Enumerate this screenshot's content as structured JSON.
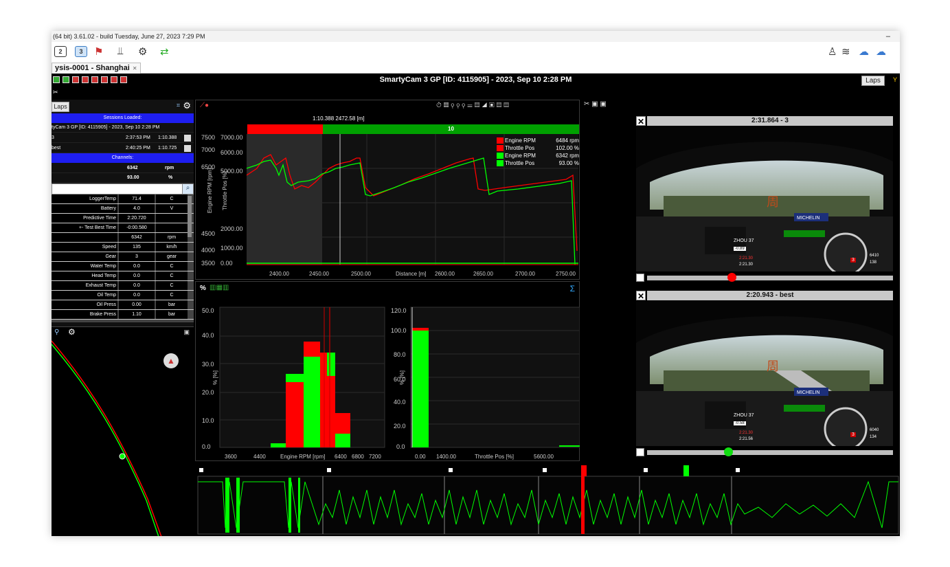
{
  "titlebar": {
    "text": "(64 bit) 3.61.02 - build Tuesday, June 27, 2023 7:29 PM",
    "minimize": "–"
  },
  "toolbar": {
    "view2": "2",
    "view3": "3"
  },
  "tab": {
    "label": "ysis-0001 - Shanghai",
    "close": "✕"
  },
  "header": {
    "title": "SmartyCam 3 GP [ID: 4115905] - 2023, Sep 10 2:28 PM",
    "laps_button": "Laps"
  },
  "left_panel": {
    "laps_button": "Laps",
    "sessions_loaded": "Sessions Loaded:",
    "session": "tyCam 3 GP [ID: 4115905] - 2023, Sep 10 2:28 PM",
    "laps": [
      {
        "name": "3",
        "time": "2:37:53 PM",
        "laptime": "1:10.388"
      },
      {
        "name": "best",
        "time": "2:40:25 PM",
        "laptime": "1:10.725"
      }
    ],
    "channels_label": "Channels:",
    "top_rows": [
      {
        "value": "6342",
        "unit": "rpm"
      },
      {
        "value": "93.00",
        "unit": "%"
      }
    ],
    "channels": [
      {
        "name": "LoggerTemp",
        "value": "71.4",
        "unit": "C"
      },
      {
        "name": "Battery",
        "value": "4.0",
        "unit": "V"
      },
      {
        "name": "Predictive Time",
        "value": "2:20.720",
        "unit": ""
      },
      {
        "name": "+- Test Best Time",
        "value": "-0:00.580",
        "unit": ""
      },
      {
        "name": "",
        "value": "6342",
        "unit": "rpm"
      },
      {
        "name": "Speed",
        "value": "135",
        "unit": "km/h"
      },
      {
        "name": "Gear",
        "value": "3",
        "unit": "gear"
      },
      {
        "name": "Water Temp",
        "value": "0.0",
        "unit": "C"
      },
      {
        "name": "Head Temp",
        "value": "0.0",
        "unit": "C"
      },
      {
        "name": "Exhaust Temp",
        "value": "0.0",
        "unit": "C"
      },
      {
        "name": "Oil Temp",
        "value": "0.0",
        "unit": "C"
      },
      {
        "name": "Oil Press",
        "value": "0.00",
        "unit": "bar"
      },
      {
        "name": "Brake Press",
        "value": "1.10",
        "unit": "bar"
      }
    ]
  },
  "main_chart": {
    "cursor_label": "1:10.388  2472.58 [m]",
    "segment_label": "10",
    "legend": [
      {
        "name": "Engine RPM",
        "value": "6484",
        "unit": "rpm",
        "color": "#ff0000"
      },
      {
        "name": "Throttle Pos",
        "value": "102.00",
        "unit": "%",
        "color": "#ff0000"
      },
      {
        "name": "Engine RPM",
        "value": "6342",
        "unit": "rpm",
        "color": "#00ff00"
      },
      {
        "name": "Throttle Pos",
        "value": "93.00",
        "unit": "%",
        "color": "#00ff00"
      }
    ],
    "y1_ticks": [
      "7500",
      "7000",
      "6500",
      "4500",
      "4000",
      "3500"
    ],
    "y2_ticks": [
      "7000.00",
      "6000.00",
      "5000.00",
      "2000.00",
      "1000.00",
      "0.00"
    ],
    "y1_label": "Engine RPM [rpm]",
    "y2_label": "Throttle Pos [%]",
    "x_ticks": [
      "2400.00",
      "2450.00",
      "2500.00",
      "2600.00",
      "2650.00",
      "2700.00",
      "2750.00"
    ],
    "x_label": "Distance [m]"
  },
  "hist1": {
    "y_ticks": [
      "50.0",
      "40.0",
      "30.0",
      "20.0",
      "10.0",
      "0.0"
    ],
    "y_label": "% [%]",
    "x_ticks": [
      "3600",
      "4400",
      "6400",
      "6800",
      "7200"
    ],
    "x_label": "Engine RPM [rpm]"
  },
  "hist2": {
    "y_ticks": [
      "120.0",
      "100.0",
      "80.0",
      "60.0",
      "40.0",
      "20.0",
      "0.0"
    ],
    "y_label": "% [%]",
    "x_ticks": [
      "0.00",
      "1400.00",
      "5600.00"
    ],
    "x_label": "Throttle Pos [%]"
  },
  "sigma": "Σ",
  "percent_tool": "%",
  "video1": {
    "title": "2:31.864 - 3",
    "hud_name": "ZHOU 37",
    "hud_delta": "-0.89",
    "hud_t1": "2:21.30",
    "hud_t2": "2:21.30",
    "rpm": "6410",
    "speed": "138",
    "gear": "3"
  },
  "video2": {
    "title": "2:20.943 - best",
    "hud_name": "ZHOU 37",
    "hud_delta": "-0.58",
    "hud_t1": "2:21.30",
    "hud_t2": "2:21.56",
    "rpm": "6040",
    "speed": "134",
    "gear": "3"
  },
  "colors": {
    "lap_red": "#ff0000",
    "lap_green": "#00e000",
    "blue_bar": "#1e1ef0"
  }
}
